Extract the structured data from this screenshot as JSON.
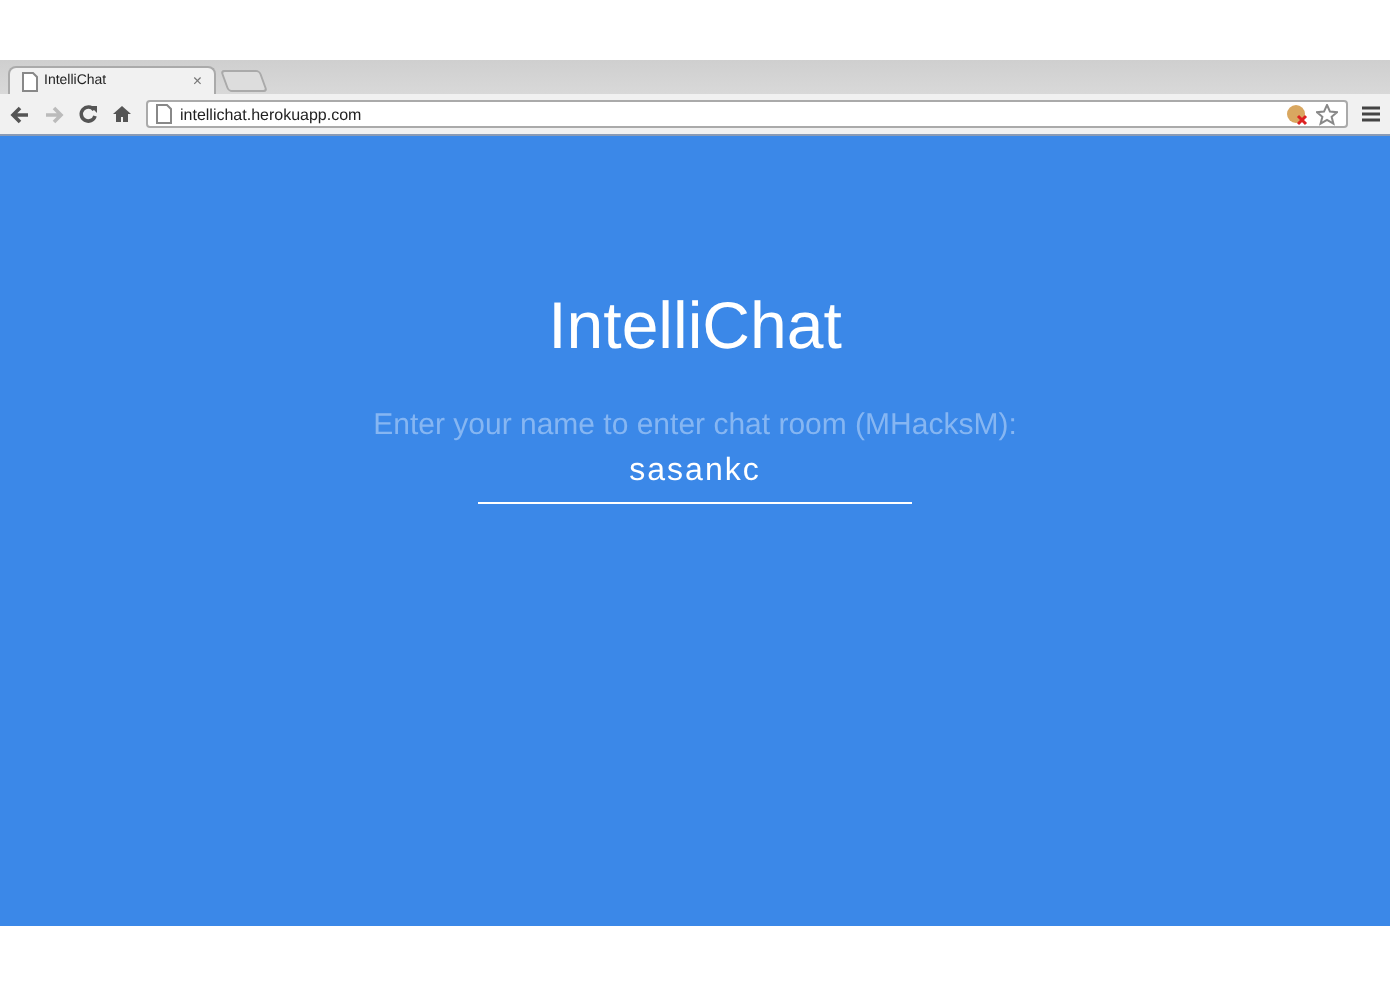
{
  "browser": {
    "tabs": [
      {
        "label": "IntelliChat",
        "selected": true,
        "close": "×"
      }
    ],
    "address": "intellichat.herokuapp.com"
  },
  "page": {
    "title": "IntelliChat",
    "prompt": "Enter your name to enter chat room (MHacksM):",
    "name_value": "sasankc"
  }
}
